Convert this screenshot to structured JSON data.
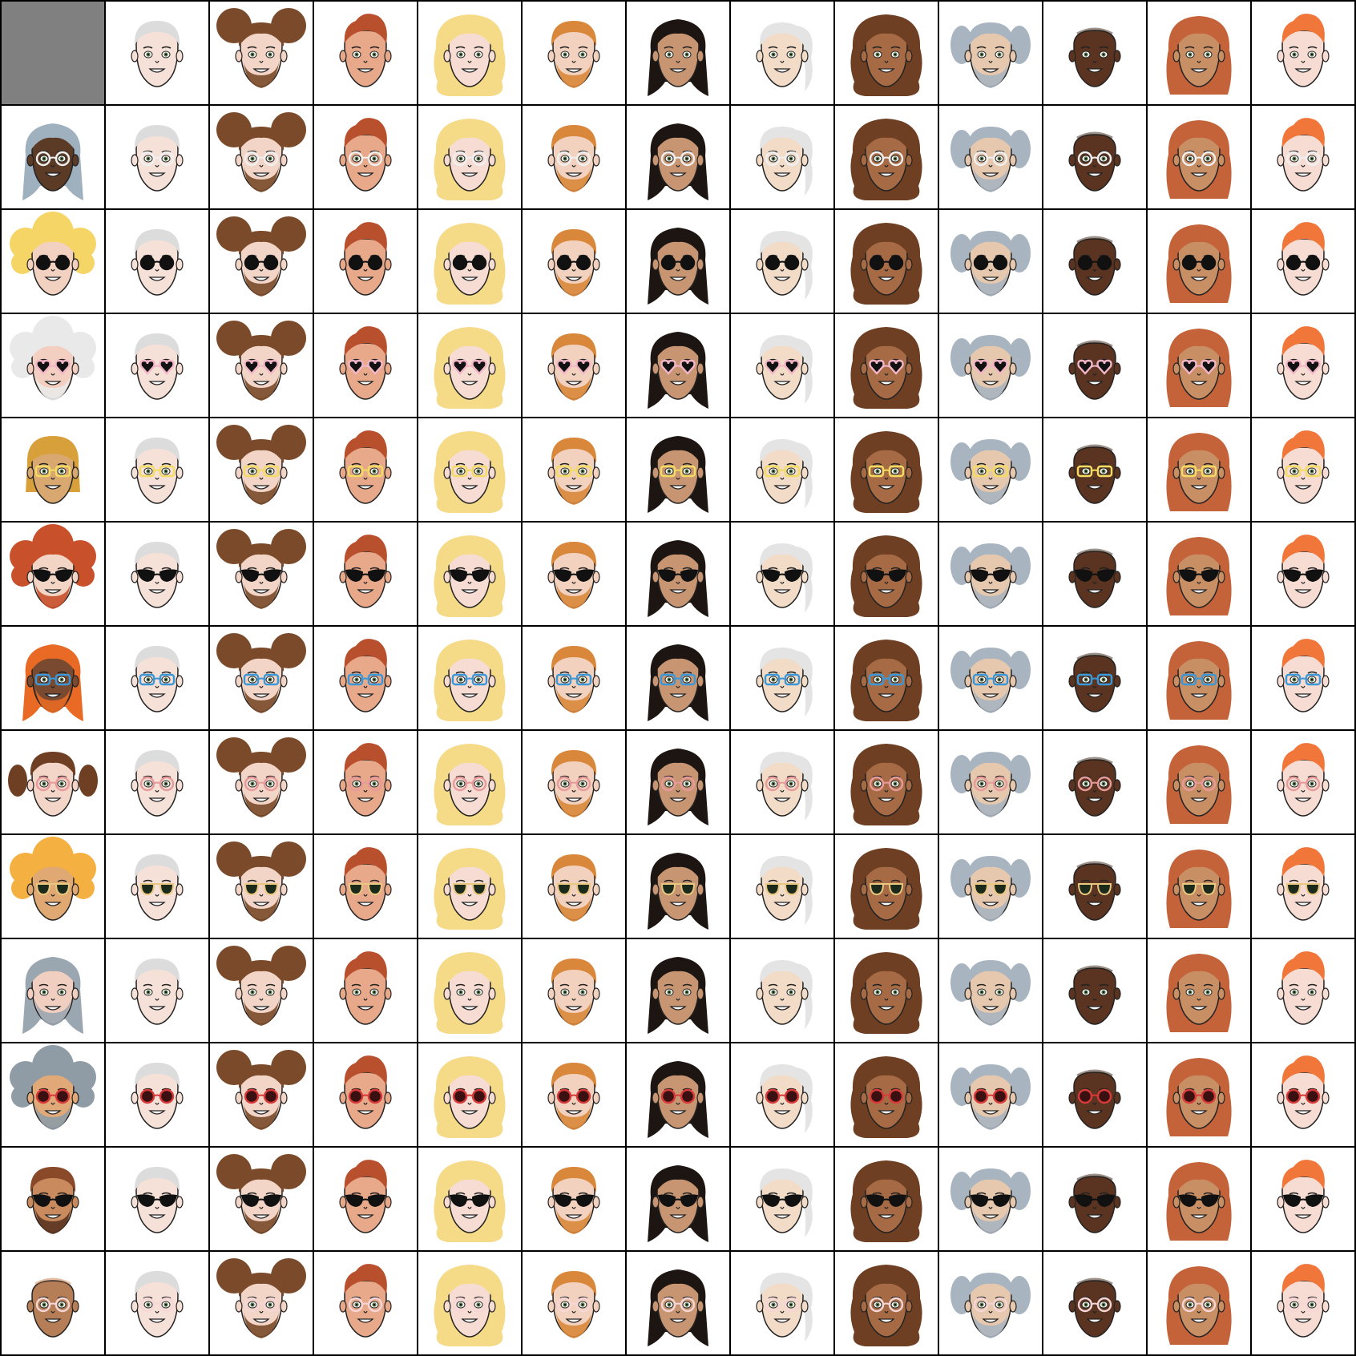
{
  "grid": {
    "rows": 13,
    "cols": 13,
    "blank_cell": [
      0,
      0
    ]
  },
  "colors": {
    "grid_line": "#000000",
    "cell_background": "#ffffff",
    "blank_cell": "#808080",
    "outline": "#222222"
  },
  "identities": [
    {
      "skin": "#f6e1d8",
      "hair": "#dcdcdc",
      "style": "short",
      "beard": null
    },
    {
      "skin": "#f2d5c7",
      "hair": "#7a4a2a",
      "style": "buns",
      "beard": "#7a4a2a"
    },
    {
      "skin": "#e8a88a",
      "hair": "#b8502e",
      "style": "quiff",
      "beard": null
    },
    {
      "skin": "#f6dcd2",
      "hair": "#f5da88",
      "style": "curlylong",
      "beard": null
    },
    {
      "skin": "#f2d2bf",
      "hair": "#d9873a",
      "style": "short",
      "beard": "#d9873a"
    },
    {
      "skin": "#c79572",
      "hair": "#1c1512",
      "style": "long",
      "beard": null
    },
    {
      "skin": "#f2dcc8",
      "hair": "#e4e4e4",
      "style": "ponytail",
      "beard": null
    },
    {
      "skin": "#a66a44",
      "hair": "#6e3f22",
      "style": "curlylong",
      "beard": null
    },
    {
      "skin": "#e6c8ae",
      "hair": "#a8b4bf",
      "style": "sidecurls",
      "beard": "#a8b4bf"
    },
    {
      "skin": "#5a3420",
      "hair": "#3a2418",
      "style": "bald",
      "beard": null
    },
    {
      "skin": "#c88e64",
      "hair": "#c4623a",
      "style": "wavylong",
      "beard": null
    },
    {
      "skin": "#f6dcd2",
      "hair": "#f0763a",
      "style": "quiff",
      "beard": null
    }
  ],
  "row_leads": [
    {
      "skin": "#5b3a26",
      "hair": "#9fb1bf",
      "style": "long",
      "beard": null
    },
    {
      "skin": "#f3d1c0",
      "hair": "#f5d565",
      "style": "curly",
      "beard": null
    },
    {
      "skin": "#f2cfc0",
      "hair": "#e9e9e9",
      "style": "curly",
      "beard": "#e9e9e9"
    },
    {
      "skin": "#d9a870",
      "hair": "#d8a03a",
      "style": "bob",
      "beard": null
    },
    {
      "skin": "#f3d5c6",
      "hair": "#c8502a",
      "style": "curly",
      "beard": "#c8502a"
    },
    {
      "skin": "#7a4a30",
      "hair": "#e86a24",
      "style": "long",
      "beard": "#e86a24"
    },
    {
      "skin": "#f4d6c8",
      "hair": "#6e3f22",
      "style": "pigtails",
      "beard": null
    },
    {
      "skin": "#e0a872",
      "hair": "#f4b040",
      "style": "curly",
      "beard": null
    },
    {
      "skin": "#f0cec0",
      "hair": "#9aa6b0",
      "style": "long",
      "beard": "#9aa6b0"
    },
    {
      "skin": "#e2a978",
      "hair": "#8f9ca6",
      "style": "curly",
      "beard": "#8f9ca6"
    },
    {
      "skin": "#c98b5e",
      "hair": "#8a4a2a",
      "style": "short",
      "beard": "#5a3420"
    },
    {
      "skin": "#b57e56",
      "hair": "#c98050",
      "style": "bald",
      "beard": null
    }
  ],
  "glasses": [
    {
      "type": "none"
    },
    {
      "type": "round",
      "frame": "#f0f0f0",
      "lens": null
    },
    {
      "type": "round",
      "frame": "#111111",
      "lens": "#111111"
    },
    {
      "type": "heart",
      "frame": "#f2b6c8",
      "lens": "#111111"
    },
    {
      "type": "rect",
      "frame": "#f3dc62",
      "lens": null
    },
    {
      "type": "cat",
      "frame": "#111111",
      "lens": "#111111"
    },
    {
      "type": "rect",
      "frame": "#3a98d8",
      "lens": null
    },
    {
      "type": "round",
      "frame": "#e89a9a",
      "lens": null
    },
    {
      "type": "aviator",
      "frame": "#e8c880",
      "lens": "#1c2a1c"
    },
    {
      "type": "none"
    },
    {
      "type": "round",
      "frame": "#d83a3a",
      "lens": "#3a1010"
    },
    {
      "type": "cat",
      "frame": "#111111",
      "lens": "#111111"
    },
    {
      "type": "round",
      "frame": "#f6d6d6",
      "lens": null
    }
  ]
}
